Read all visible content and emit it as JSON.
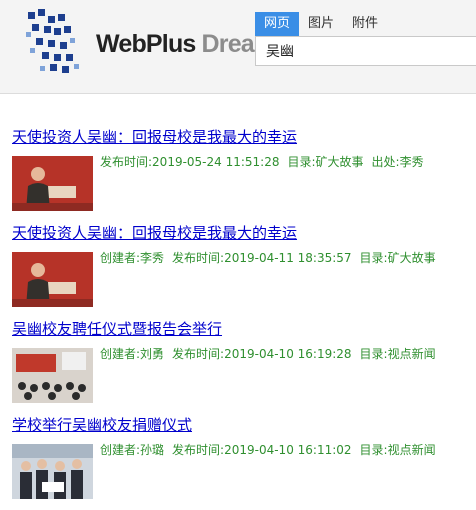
{
  "header": {
    "logo": {
      "brand": "WebPlus",
      "product": "Dreamer"
    },
    "tabs": [
      {
        "label": "网页",
        "active": true
      },
      {
        "label": "图片",
        "active": false
      },
      {
        "label": "附件",
        "active": false
      }
    ],
    "search": {
      "value": "吴幽"
    }
  },
  "results": [
    {
      "title": "天使投资人吴幽：回报母校是我最大的幸运",
      "meta": [
        "发布时间:2019-05-24 11:51:28",
        "目录:矿大故事",
        "出处:李秀"
      ],
      "thumb": "red stage speaker"
    },
    {
      "title": "天使投资人吴幽：回报母校是我最大的幸运",
      "meta": [
        "创建者:李秀",
        "发布时间:2019-04-11 18:35:57",
        "目录:矿大故事"
      ],
      "thumb": "red stage speaker"
    },
    {
      "title": "吴幽校友聘任仪式暨报告会举行",
      "meta": [
        "创建者:刘勇",
        "发布时间:2019-04-10 16:19:28",
        "目录:视点新闻"
      ],
      "thumb": "lecture hall audience"
    },
    {
      "title": "学校举行吴幽校友捐赠仪式",
      "meta": [
        "创建者:孙璐",
        "发布时间:2019-04-10 16:11:02",
        "目录:视点新闻"
      ],
      "thumb": "group photo"
    }
  ]
}
